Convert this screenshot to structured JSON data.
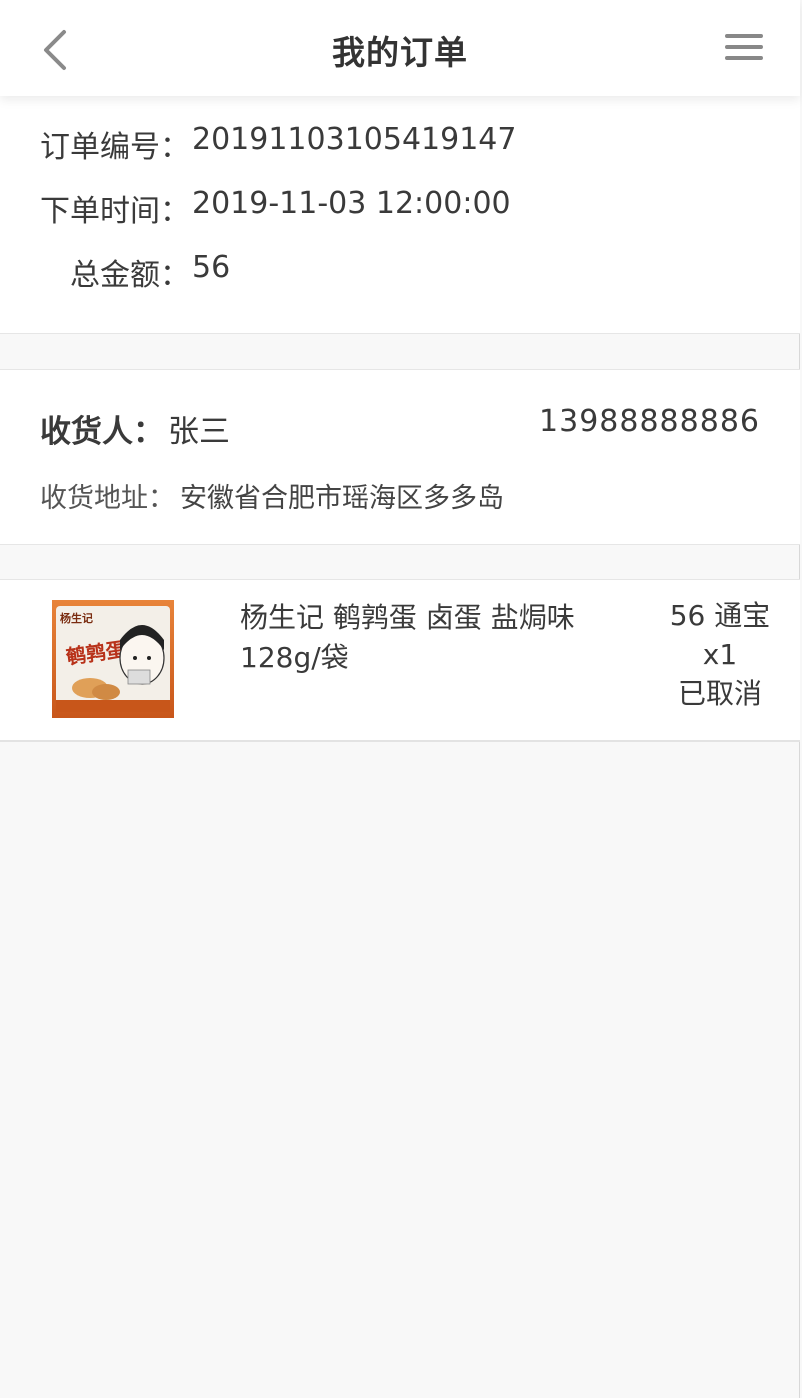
{
  "header": {
    "title": "我的订单",
    "back_icon": "chevron-left-icon",
    "menu_icon": "hamburger-menu-icon"
  },
  "order": {
    "number_label": "订单编号：",
    "number": "20191103105419147",
    "time_label": "下单时间：",
    "time": "2019-11-03 12:00:00",
    "total_label": "总金额：",
    "total": "56"
  },
  "receiver": {
    "name_label": "收货人：",
    "name": "张三",
    "phone": "13988888886",
    "address_label": "收货地址：",
    "address": "安徽省合肥市瑶海区多多岛"
  },
  "product": {
    "name": "杨生记 鹌鹑蛋 卤蛋 盐焗味128g/袋",
    "price": "56 通宝",
    "quantity": "x1",
    "status": "已取消",
    "image_brand_text": "杨生记",
    "image_title_text": "鹌鹑蛋"
  },
  "colors": {
    "background": "#f8f8f8",
    "card": "#ffffff",
    "text": "#333333",
    "package_orange": "#d9691f"
  }
}
